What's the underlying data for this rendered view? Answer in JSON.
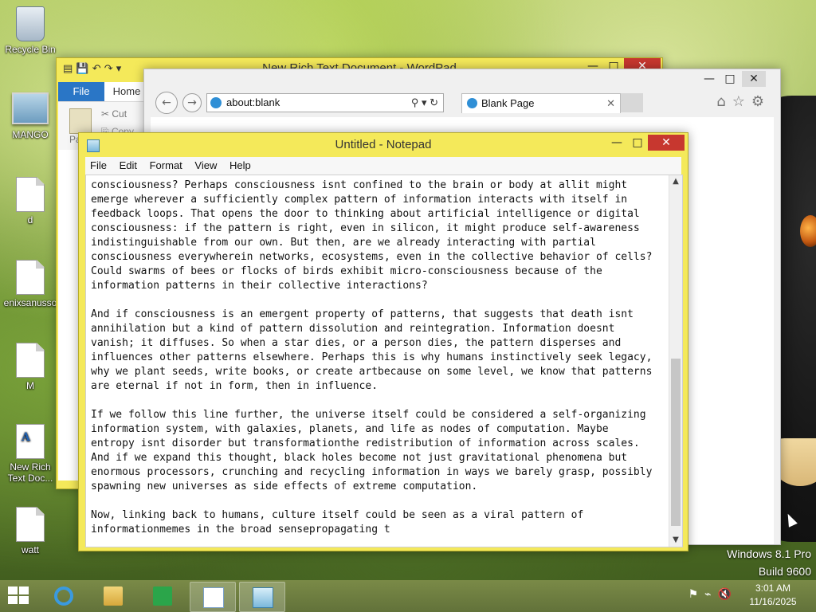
{
  "desktop": {
    "icons": [
      {
        "label": "Recycle Bin"
      },
      {
        "label": "MANGO"
      },
      {
        "label": "d"
      },
      {
        "label": "enixsanusso"
      },
      {
        "label": "M"
      },
      {
        "label": "New Rich Text Doc..."
      },
      {
        "label": "watt"
      }
    ],
    "watermark": {
      "line1": "Windows 8.1 Pro",
      "line2": "Build 9600"
    }
  },
  "wordpad": {
    "title": "New Rich Text Document - WordPad",
    "tabs": {
      "file": "File",
      "home": "Home"
    },
    "clipboard": {
      "cut": "Cut",
      "copy": "Copy",
      "paste": "Pa"
    }
  },
  "ie": {
    "address": "about:blank",
    "tab_label": "Blank Page"
  },
  "notepad": {
    "title": "Untitled - Notepad",
    "menu": {
      "file": "File",
      "edit": "Edit",
      "format": "Format",
      "view": "View",
      "help": "Help"
    },
    "text": "consciousness? Perhaps consciousness isnt confined to the brain or body at allit might\nemerge wherever a sufficiently complex pattern of information interacts with itself in\nfeedback loops. That opens the door to thinking about artificial intelligence or digital\nconsciousness: if the pattern is right, even in silicon, it might produce self-awareness\nindistinguishable from our own. But then, are we already interacting with partial\nconsciousness everywherein networks, ecosystems, even in the collective behavior of cells?\nCould swarms of bees or flocks of birds exhibit micro-consciousness because of the\ninformation patterns in their collective interactions?\n\nAnd if consciousness is an emergent property of patterns, that suggests that death isnt\nannihilation but a kind of pattern dissolution and reintegration. Information doesnt\nvanish; it diffuses. So when a star dies, or a person dies, the pattern disperses and\ninfluences other patterns elsewhere. Perhaps this is why humans instinctively seek legacy,\nwhy we plant seeds, write books, or create artbecause on some level, we know that patterns\nare eternal if not in form, then in influence.\n\nIf we follow this line further, the universe itself could be considered a self-organizing\ninformation system, with galaxies, planets, and life as nodes of computation. Maybe\nentropy isnt disorder but transformationthe redistribution of information across scales.\nAnd if we expand this thought, black holes become not just gravitational phenomena but\nenormous processors, crunching and recycling information in ways we barely grasp, possibly\nspawning new universes as side effects of extreme computation.\n\nNow, linking back to humans, culture itself could be seen as a viral pattern of\ninformationmemes in the broad sensepropagating t"
  },
  "taskbar": {
    "buttons": [
      {
        "icon": "ie-icon"
      },
      {
        "icon": "file-explorer-icon"
      },
      {
        "icon": "store-icon"
      },
      {
        "icon": "wordpad-icon"
      },
      {
        "icon": "notepad-icon"
      }
    ],
    "time": "3:01 AM",
    "date": "11/16/2025"
  }
}
